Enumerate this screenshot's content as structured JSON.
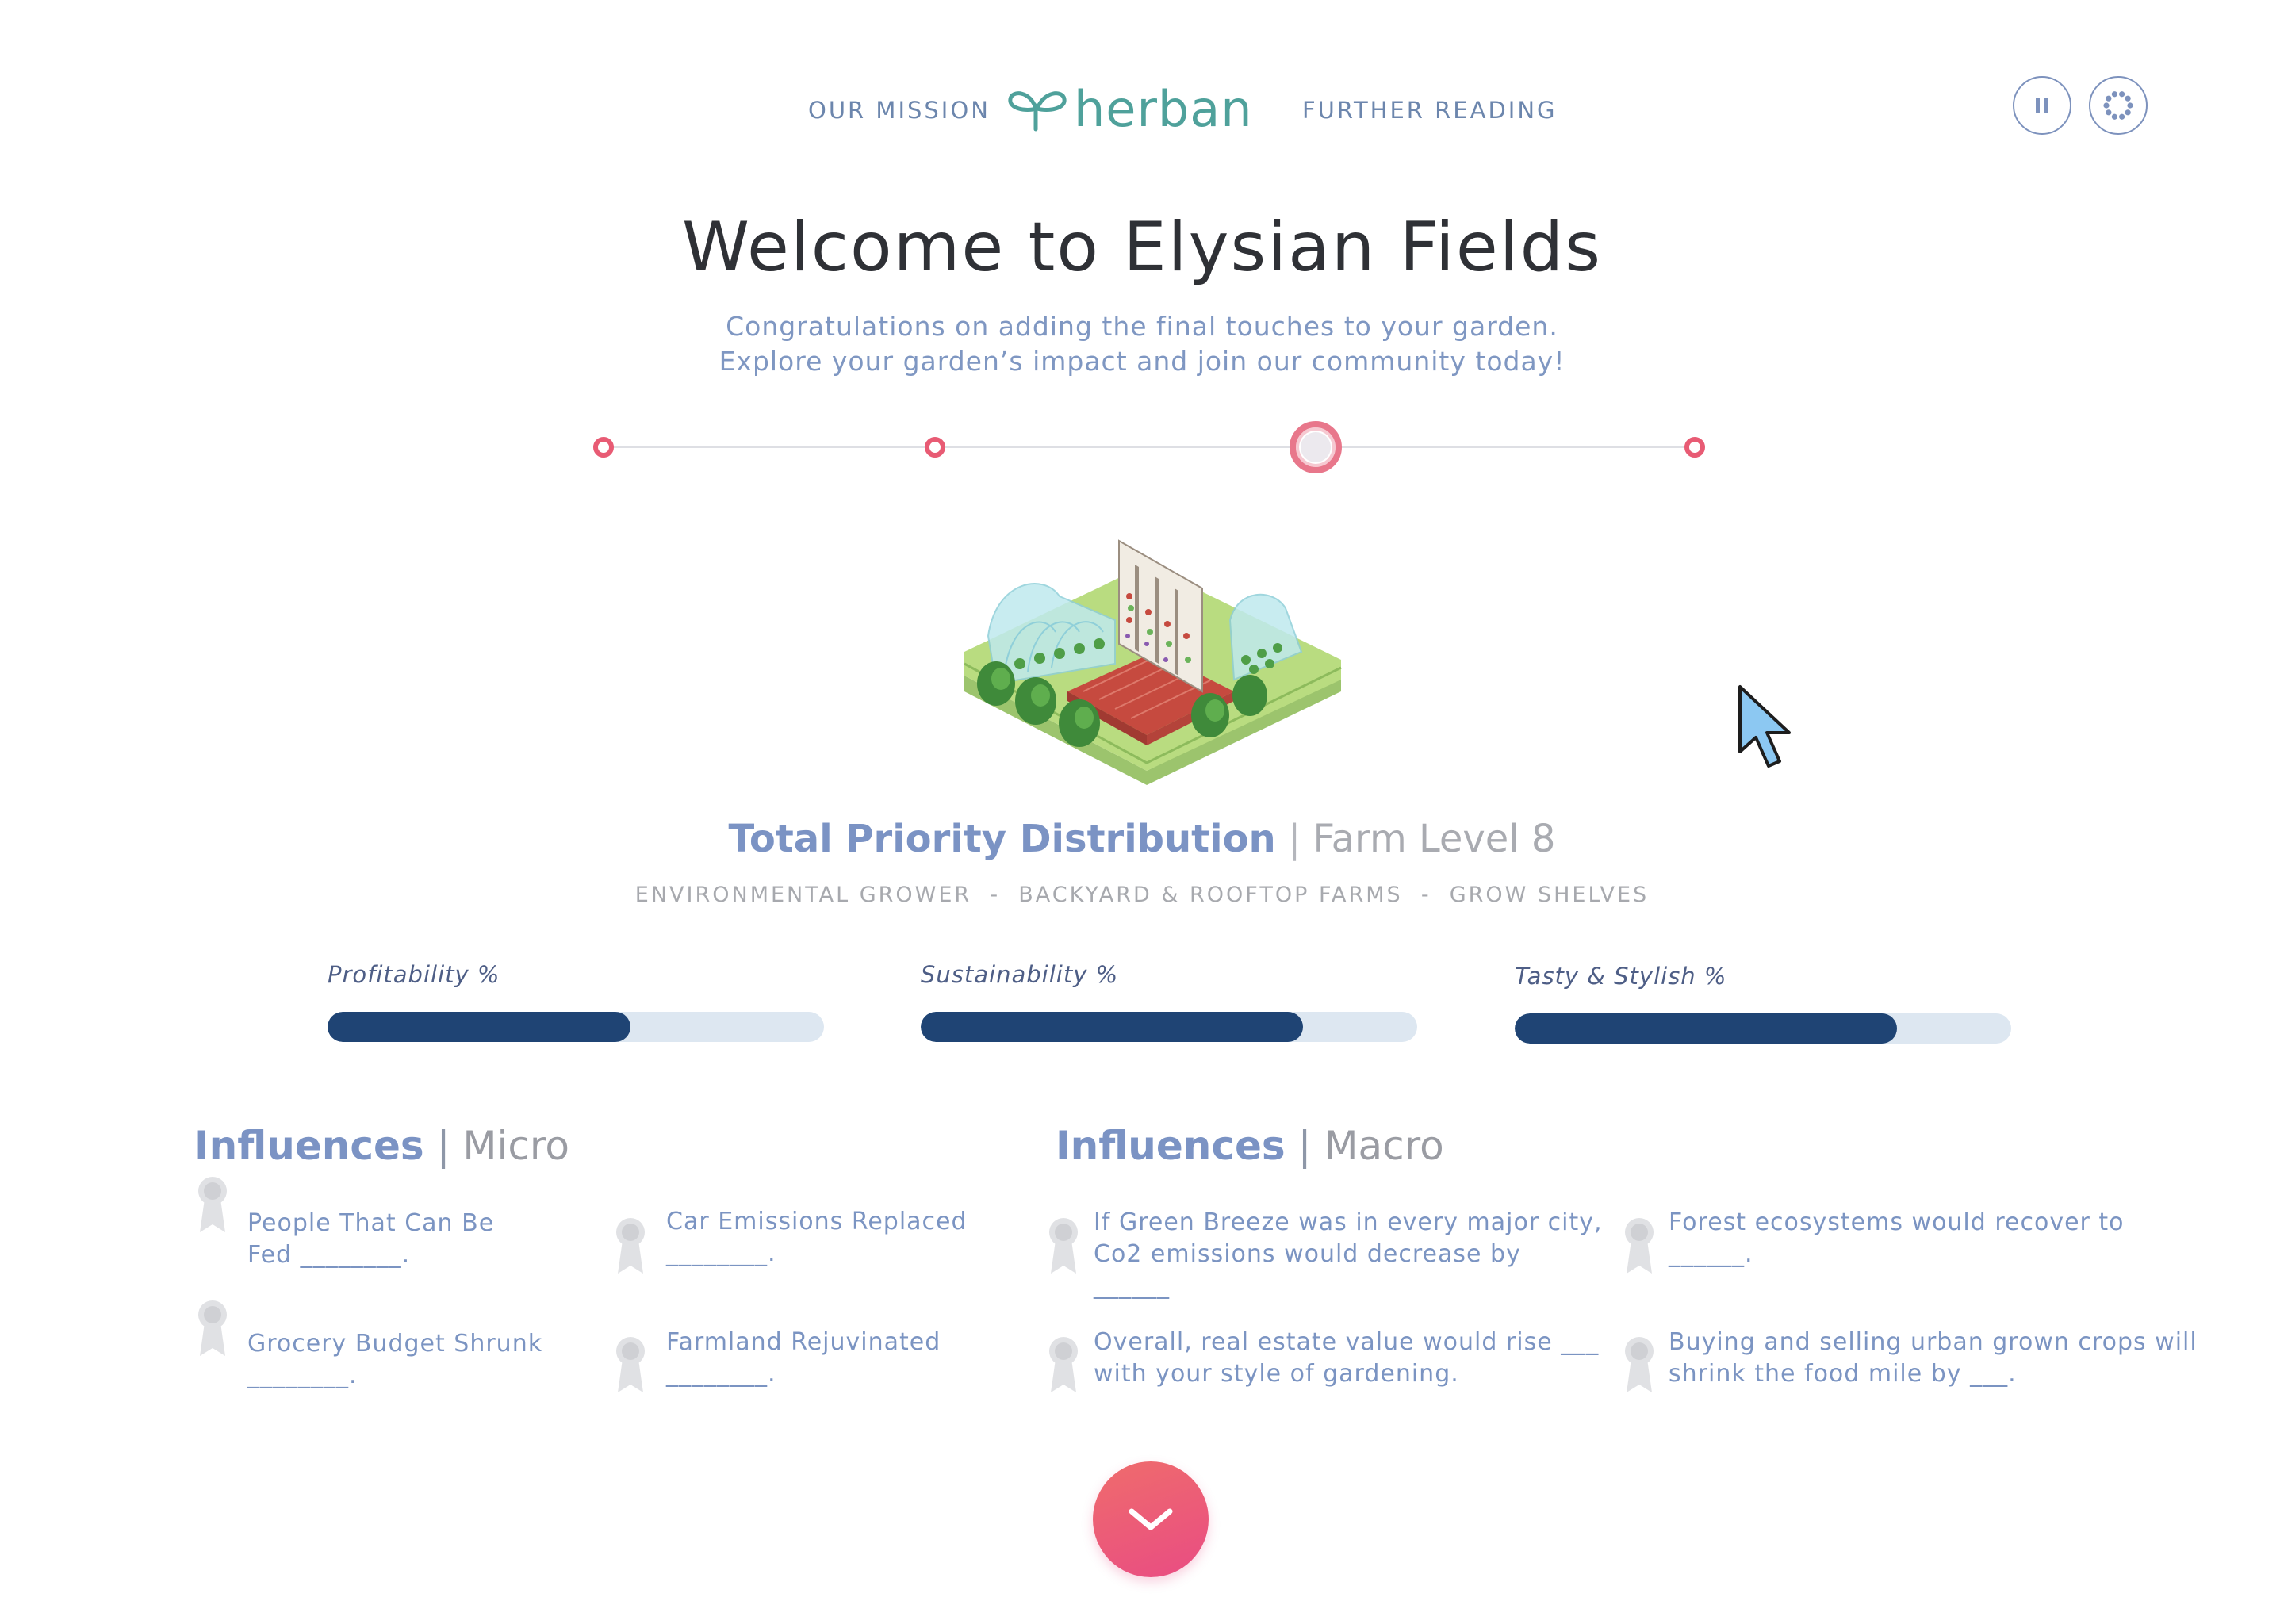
{
  "header": {
    "nav_left": "OUR MISSION",
    "nav_right": "FURTHER READING",
    "logo_text": "herban",
    "brand_color": "#4fa19b",
    "controls": [
      {
        "name": "pause",
        "icon": "pause-icon"
      },
      {
        "name": "loading",
        "icon": "dots-ring-icon"
      }
    ]
  },
  "hero": {
    "title": "Welcome to Elysian Fields",
    "subtitle_line1": "Congratulations on adding the final touches to your garden.",
    "subtitle_line2": "Explore your garden’s impact and join our community today!"
  },
  "stepper": {
    "steps": 4,
    "active_index": 2,
    "accent": "#e85b74"
  },
  "illustration": {
    "icon": "isometric-urban-farm-illustration"
  },
  "priority": {
    "title": "Total Priority Distribution",
    "separator": "|",
    "level": "Farm Level 8",
    "tags": "ENVIRONMENTAL GROWER  -  BACKYARD & ROOFTOP FARMS  -  GROW SHELVES"
  },
  "bars": [
    {
      "label": "Profitability %",
      "value": 0.61
    },
    {
      "label": "Sustainability %",
      "value": 0.77
    },
    {
      "label": "Tasty & Stylish %",
      "value": 0.77
    }
  ],
  "influences_micro": {
    "title": "Influences",
    "sep": "|",
    "subtitle": "Micro",
    "items": [
      {
        "line1": "People That Can Be",
        "line2": "Fed ________."
      },
      {
        "line1": "Car Emissions Replaced",
        "line2": "________."
      },
      {
        "line1": "Grocery Budget Shrunk",
        "line2": "________."
      },
      {
        "line1": "Farmland Rejuvinated",
        "line2": "________."
      }
    ]
  },
  "influences_macro": {
    "title": "Influences",
    "sep": "|",
    "subtitle": "Macro",
    "items": [
      {
        "line1": "If Green Breeze was in every major city,",
        "line2": "Co2 emissions would decrease by",
        "line3": "______"
      },
      {
        "line1": "Forest ecosystems would recover to",
        "line2": "______."
      },
      {
        "line1": "Overall, real estate value would rise ___",
        "line2": "with your style of gardening."
      },
      {
        "line1": "Buying and selling urban grown crops will",
        "line2": "shrink the food mile by ___."
      }
    ]
  },
  "cta": {
    "icon": "chevron-down-icon"
  },
  "colors": {
    "bar_fill": "#1f4474",
    "bar_track": "#dde7f1",
    "cta_start": "#ef6c6c",
    "cta_end": "#e94c83"
  }
}
